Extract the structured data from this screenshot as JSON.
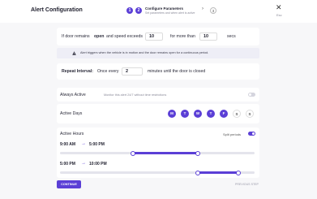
{
  "header": {
    "title": "Alert Configuration",
    "steps": [
      "1",
      "2"
    ],
    "step_title": "Configure Parameters",
    "step_subtitle": "Set parameters and when alert is active",
    "next_step": "3",
    "close_label": "Esc"
  },
  "condition": {
    "prefix": "If door remains",
    "state": "open",
    "middle": "and speed exceeds",
    "speed_value": "10",
    "for_text": "for more than",
    "duration_value": "10",
    "unit": "secs"
  },
  "info": {
    "text": "Alert triggers when the vehicle is in motion and the door remains open for a continuous period."
  },
  "repeat": {
    "label": "Repeat Interval:",
    "prefix": "Once every",
    "value": "2",
    "suffix": "minutes until the door is closed"
  },
  "always_active": {
    "label": "Always Active",
    "hint": "Monitor this alert 24/7 without time restrictions",
    "enabled": false
  },
  "active_days": {
    "label": "Active Days",
    "days": [
      {
        "letter": "M",
        "active": true
      },
      {
        "letter": "T",
        "active": true
      },
      {
        "letter": "W",
        "active": true
      },
      {
        "letter": "T",
        "active": true
      },
      {
        "letter": "F",
        "active": true
      },
      {
        "letter": "S",
        "active": false
      },
      {
        "letter": "S",
        "active": false
      }
    ]
  },
  "active_hours": {
    "label": "Active Hours",
    "split_label": "Split periods",
    "split_enabled": true,
    "periods": [
      {
        "start": "9:00 AM",
        "end": "5:00 PM",
        "start_frac": 0.375,
        "end_frac": 0.708
      },
      {
        "start": "5:00 PM",
        "end": "10:00 PM",
        "start_frac": 0.708,
        "end_frac": 0.917
      }
    ]
  },
  "footer": {
    "continue_label": "CONTINUE",
    "previous_label": "PREVIOUS STEP"
  },
  "colors": {
    "accent": "#5b3fd6",
    "background": "#f7f7f9"
  }
}
